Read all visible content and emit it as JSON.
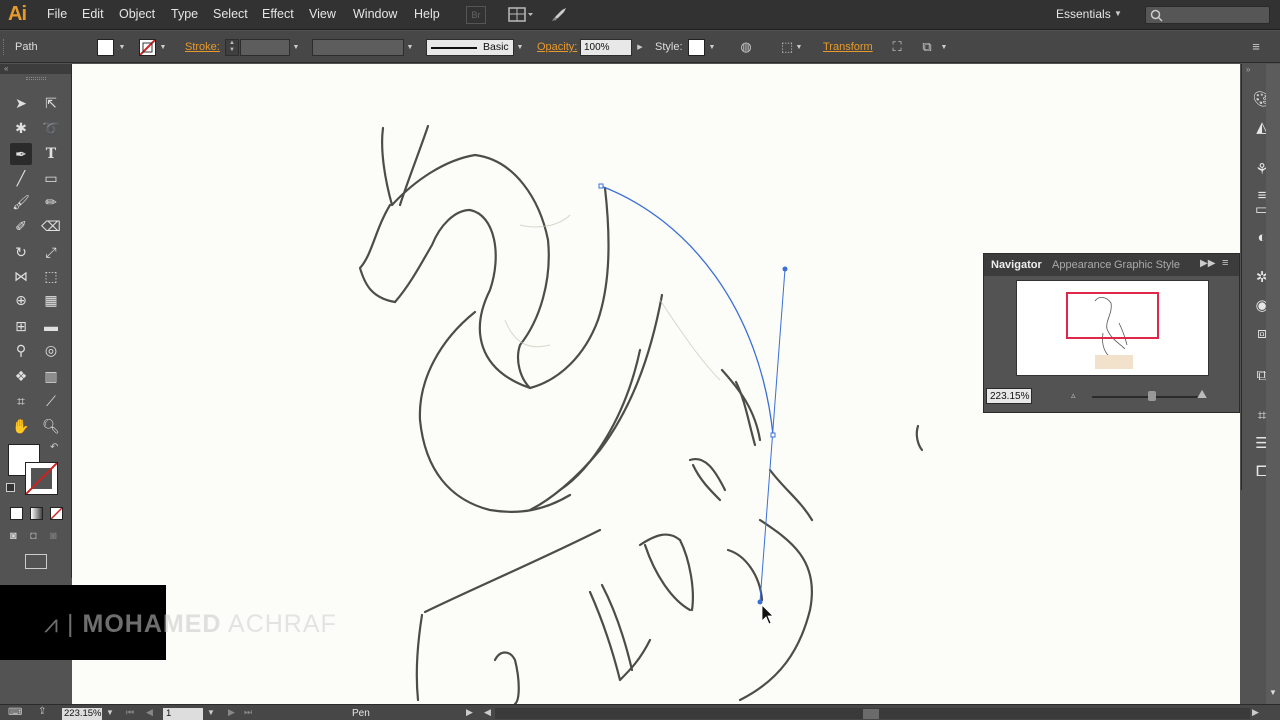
{
  "app": {
    "logo": "Ai",
    "brand_color": "#e79a2c"
  },
  "menu": {
    "items": [
      "File",
      "Edit",
      "Object",
      "Type",
      "Select",
      "Effect",
      "View",
      "Window",
      "Help"
    ],
    "bridge_label": "Br",
    "workspace": "Essentials"
  },
  "control": {
    "selection_type": "Path",
    "stroke_label": "Stroke:",
    "brush_label": "Basic",
    "opacity_label": "Opacity:",
    "opacity_value": "100%",
    "style_label": "Style:",
    "transform_label": "Transform"
  },
  "navigator": {
    "tabs": [
      "Navigator",
      "Appearance",
      "Graphic Style"
    ],
    "zoom": "223.15%",
    "view_rect_color": "#e0274a"
  },
  "watermark": {
    "name_bold": "MOHAMED",
    "name_light": "ACHRAF"
  },
  "status": {
    "zoom": "223.15%",
    "page": "1",
    "current_tool": "Pen"
  },
  "canvas": {
    "path_color": "#3a6fd8",
    "sketch_color": "#2f2f2a"
  }
}
